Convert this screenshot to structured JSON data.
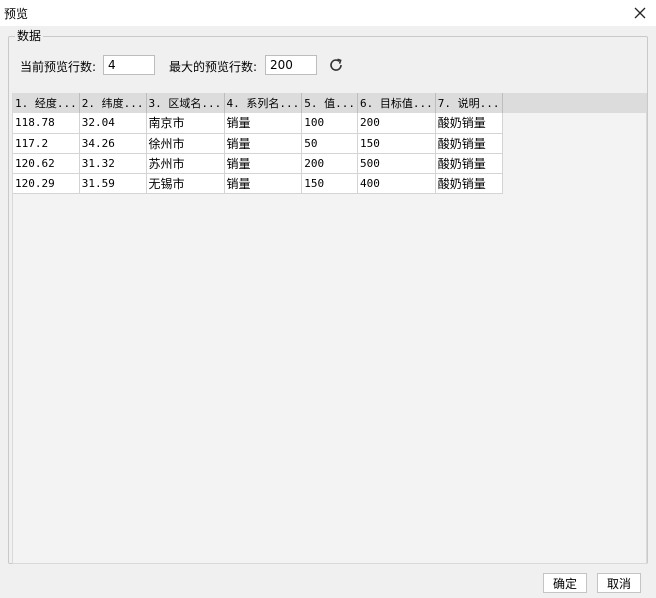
{
  "window": {
    "title": "预览"
  },
  "group": {
    "label": "数据"
  },
  "controls": {
    "current_rows_label": "当前预览行数:",
    "current_rows_value": "4",
    "max_rows_label": "最大的预览行数:",
    "max_rows_value": "200"
  },
  "table": {
    "headers": [
      "1. 经度...",
      "2. 纬度...",
      "3. 区域名...",
      "4. 系列名...",
      "5. 值...",
      "6. 目标值...",
      "7. 说明..."
    ],
    "rows": [
      [
        "118.78",
        "32.04",
        "南京市",
        "销量",
        "100",
        "200",
        "酸奶销量"
      ],
      [
        "117.2",
        "34.26",
        "徐州市",
        "销量",
        "50",
        "150",
        "酸奶销量"
      ],
      [
        "120.62",
        "31.32",
        "苏州市",
        "销量",
        "200",
        "500",
        "酸奶销量"
      ],
      [
        "120.29",
        "31.59",
        "无锡市",
        "销量",
        "150",
        "400",
        "酸奶销量"
      ]
    ]
  },
  "buttons": {
    "ok": "确定",
    "cancel": "取消"
  },
  "icons": {
    "close": "close-icon",
    "refresh": "refresh-icon"
  }
}
